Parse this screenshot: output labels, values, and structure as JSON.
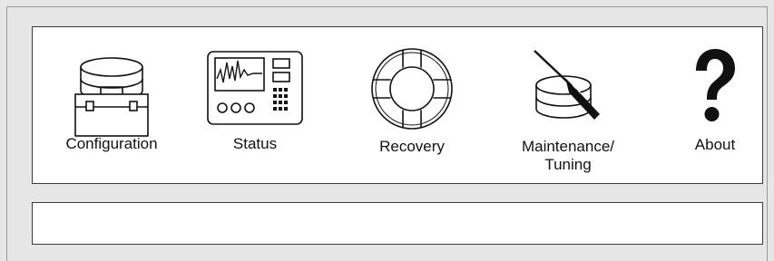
{
  "toolbar": {
    "items": [
      {
        "label": "Configuration",
        "icon": "database-toolbox-icon"
      },
      {
        "label": "Status",
        "icon": "monitor-panel-icon"
      },
      {
        "label": "Recovery",
        "icon": "life-ring-icon"
      },
      {
        "label": "Maintenance/\nTuning",
        "icon": "database-screwdriver-icon"
      },
      {
        "label": "About",
        "icon": "question-mark-icon"
      }
    ]
  },
  "message_area": {
    "text": ""
  }
}
